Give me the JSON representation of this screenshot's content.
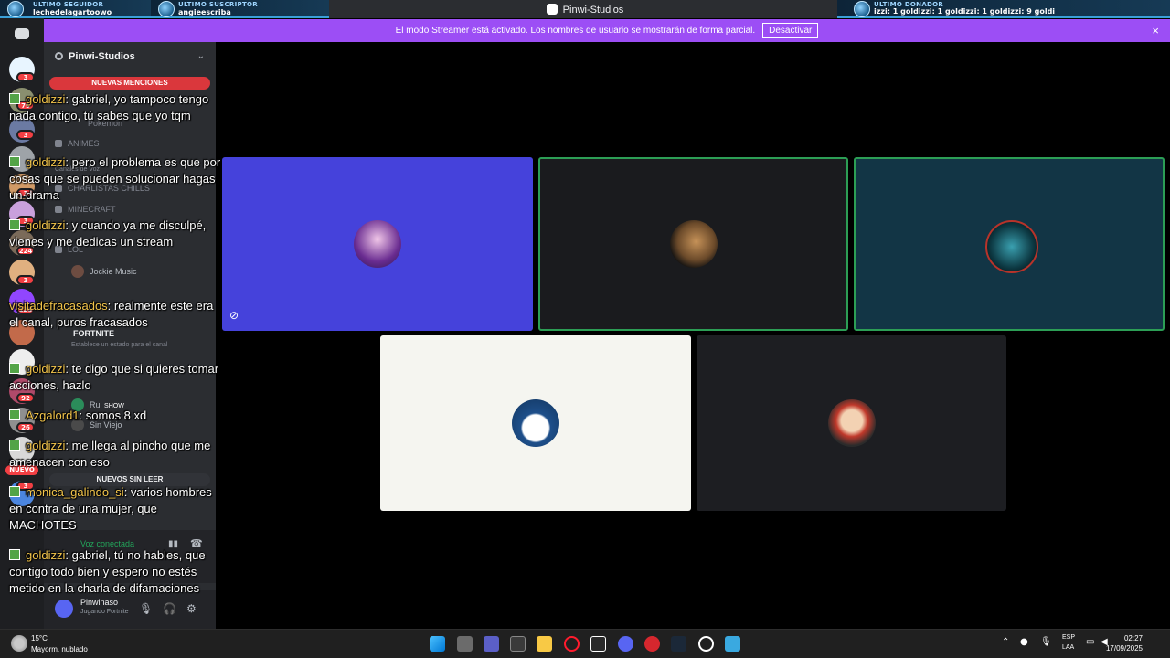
{
  "overlay": {
    "follower_title": "ULTIMO SEGUIDOR",
    "follower_name": "lechedelagartoowo",
    "subscriber_title": "ULTIMO SUSCRIPTOR",
    "subscriber_name": "angieescriba",
    "donor_title": "ULTIMO DONADOR",
    "ticker": "izzi:   1   goldizzi:   1   goldizzi:   1   goldizzi:   9   goldi"
  },
  "window": {
    "title": "Pinwi-Studios"
  },
  "banner": {
    "text": "El modo Streamer está activado. Los nombres de usuario se mostrarán de forma parcial.",
    "button": "Desactivar",
    "close": "×"
  },
  "rail": {
    "badges": [
      "3",
      "79",
      "3",
      "3",
      "3",
      "224",
      "3",
      "128",
      "92",
      "26",
      "NUEVO",
      "3"
    ]
  },
  "sidebar": {
    "server_name": "Pinwi-Studios",
    "chevron": "⌄",
    "mentions_label": "NUEVAS MENCIONES",
    "unread_label": "NUEVOS SIN LEER",
    "channels": {
      "pokemon": "Pokemon",
      "animes": "ANIMES",
      "voice_header": "Canales de Voz",
      "charlistas": "CHARLISTAS CHILLS",
      "minecraft": "MINECRAFT",
      "lol": "LOL",
      "fortnite": "FORTNITE",
      "fortnite_status": "Establece un estado para el canal"
    },
    "voice_users": [
      "Jockie Music",
      "Rui",
      "Sin Viejo"
    ],
    "voice_tag": "SHOW",
    "voice_connected": "Voz conectada",
    "user_name": "Pinwinaso",
    "user_status": "Jugando Fortnite"
  },
  "chat": [
    {
      "author": "goldizzi",
      "text": "gabriel, yo tampoco tengo nada contigo, tú sabes que yo tqm"
    },
    {
      "author": "goldizzi",
      "text": "pero el problema es que por cosas que se pueden solucionar hagas un drama"
    },
    {
      "author": "goldizzi",
      "text": "y cuando ya me disculpé, vienes y me dedicas un stream"
    },
    {
      "author": "visitadefracasados",
      "text": "realmente este era el canal, puros fracasados"
    },
    {
      "author": "goldizzi",
      "text": "te digo que si quieres tomar acciones, hazlo"
    },
    {
      "author": "Azgalord1",
      "text": "somos 8 xd"
    },
    {
      "author": "goldizzi",
      "text": "me llega al pincho que me amenacen con eso"
    },
    {
      "author": "monica_galindo_si",
      "text": "varios hombres en contra de una mujer, que MACHOTES"
    },
    {
      "author": "goldizzi",
      "text": "gabriel, tú no hables, que contigo todo bien y espero no estés metido en la charla de difamaciones"
    }
  ],
  "taskbar": {
    "temp": "15°C",
    "weather": "Mayorm. nublado",
    "lang1": "ESP",
    "lang2": "LAA",
    "time": "02:27",
    "date": "17/09/2025"
  }
}
